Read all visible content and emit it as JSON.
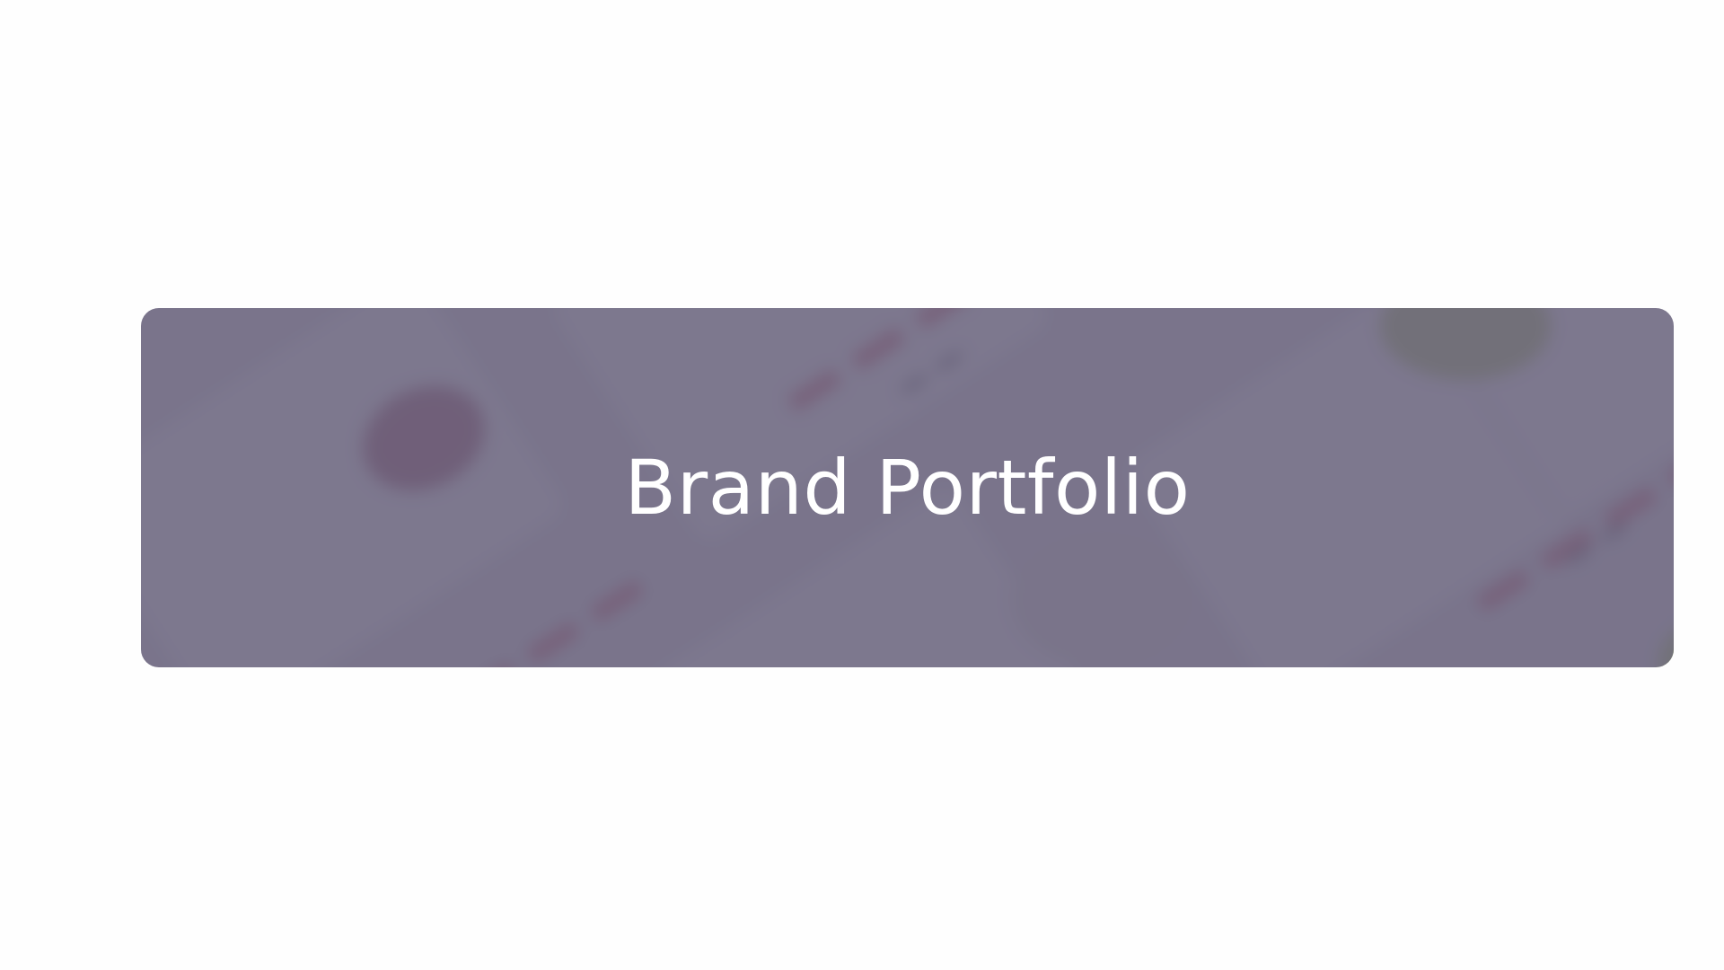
{
  "banner": {
    "title": "Brand Portfolio"
  },
  "colors": {
    "page_background": "#fefefe",
    "overlay": "#6c6680",
    "title_text": "#ffffff",
    "accent_red": "#c3364f",
    "accent_green": "#8aa836"
  }
}
